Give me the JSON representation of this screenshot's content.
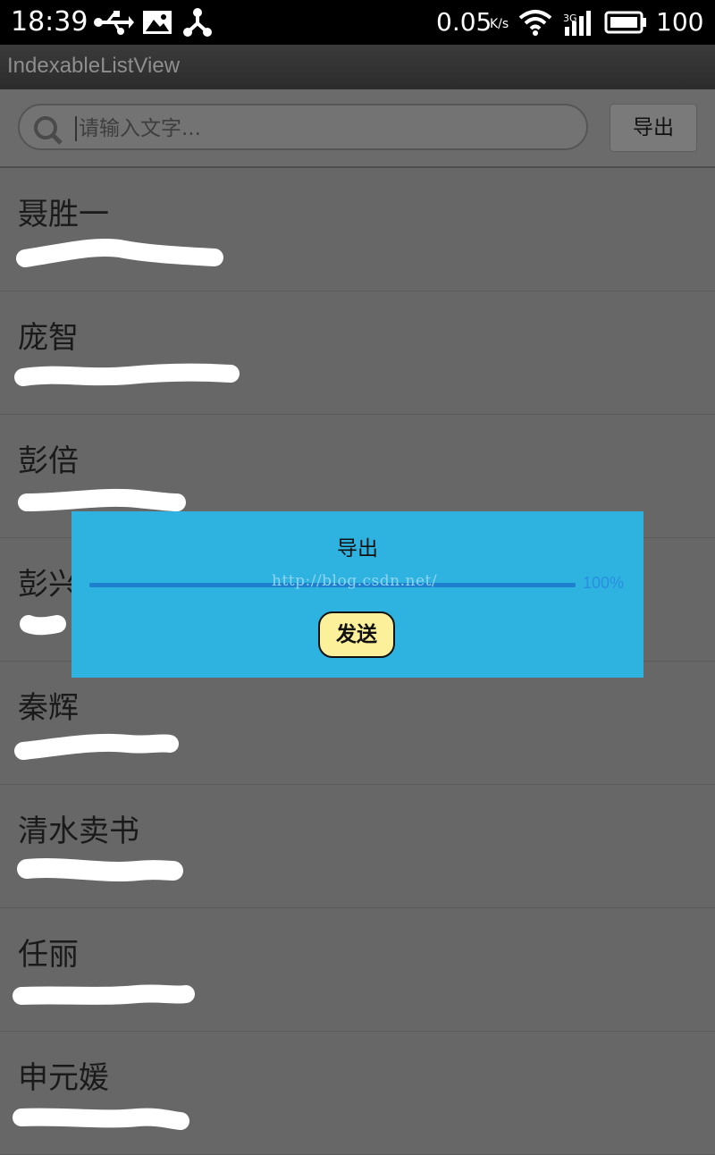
{
  "status_bar": {
    "time": "18:39",
    "net_speed": "0.05",
    "net_unit": "K/s",
    "network": "3G",
    "battery": "100"
  },
  "app": {
    "title": "IndexableListView"
  },
  "search": {
    "placeholder": "请输入文字...",
    "value": ""
  },
  "toolbar": {
    "export_label": "导出"
  },
  "contacts": [
    {
      "name": "聂胜一"
    },
    {
      "name": "庞智"
    },
    {
      "name": "彭倍"
    },
    {
      "name": "彭兴"
    },
    {
      "name": "秦辉"
    },
    {
      "name": "清水卖书"
    },
    {
      "name": "任丽"
    },
    {
      "name": "申元媛"
    }
  ],
  "dialog": {
    "title": "导出",
    "progress_percent": 100,
    "progress_text": "100%",
    "watermark": "http://blog.csdn.net/",
    "send_label": "发送"
  },
  "colors": {
    "dialog_bg": "#2eb3e1",
    "send_button_bg": "#fdf09b",
    "overlay_bg": "#676767"
  }
}
